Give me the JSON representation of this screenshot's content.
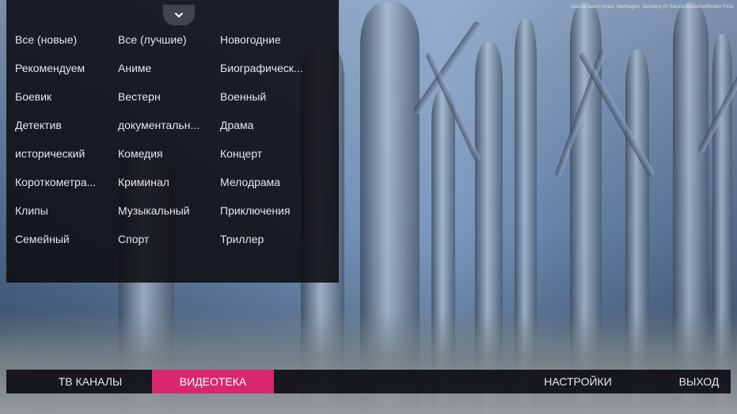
{
  "background": {
    "credit": "Coastal beech forest, Nienhagen, Germany (© Sandra Bartocha/Minden Pictu"
  },
  "genres": {
    "col1": [
      "Все (новые)",
      "Рекомендуем",
      "Боевик",
      "Детектив",
      "исторический",
      "Короткометра...",
      "Клипы",
      "Семейный"
    ],
    "col2": [
      "Все (лучшие)",
      "Аниме",
      "Вестерн",
      "документальн...",
      "Комедия",
      "Криминал",
      "Музыкальный",
      "Спорт"
    ],
    "col3": [
      "Новогодние",
      "Биографическ...",
      "Военный",
      "Драма",
      "Концерт",
      "Мелодрама",
      "Приключения",
      "Триллер"
    ]
  },
  "nav": {
    "tv_channels": "ТВ КАНАЛЫ",
    "video_library": "ВИДЕОТЕКА",
    "settings": "НАСТРОЙКИ",
    "exit": "ВЫХОД",
    "active": "video_library"
  },
  "colors": {
    "accent": "#d8286b",
    "panel": "#0c0c10"
  }
}
